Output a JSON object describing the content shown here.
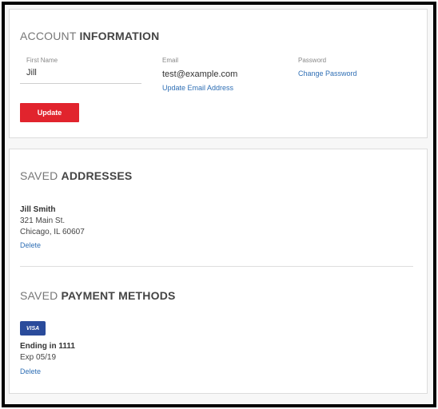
{
  "account": {
    "title_light": "ACCOUNT",
    "title_bold": "INFORMATION",
    "first_name_label": "First Name",
    "first_name_value": "Jill",
    "email_label": "Email",
    "email_value": "test@example.com",
    "update_email_link": "Update Email Address",
    "password_label": "Password",
    "change_password_link": "Change Password",
    "update_button": "Update"
  },
  "addresses": {
    "title_light": "SAVED",
    "title_bold": "ADDRESSES",
    "items": [
      {
        "name": "Jill Smith",
        "line1": "321 Main St.",
        "line2": "Chicago, IL 60607",
        "delete_label": "Delete"
      }
    ]
  },
  "payments": {
    "title_light": "SAVED",
    "title_bold": "PAYMENT METHODS",
    "items": [
      {
        "card_brand": "VISA",
        "ending": "Ending in 1111",
        "expiry": "Exp 05/19",
        "delete_label": "Delete"
      }
    ]
  },
  "colors": {
    "accent_red": "#e1242d",
    "link_blue": "#2f6fb5",
    "visa_blue": "#2a4b9b"
  }
}
